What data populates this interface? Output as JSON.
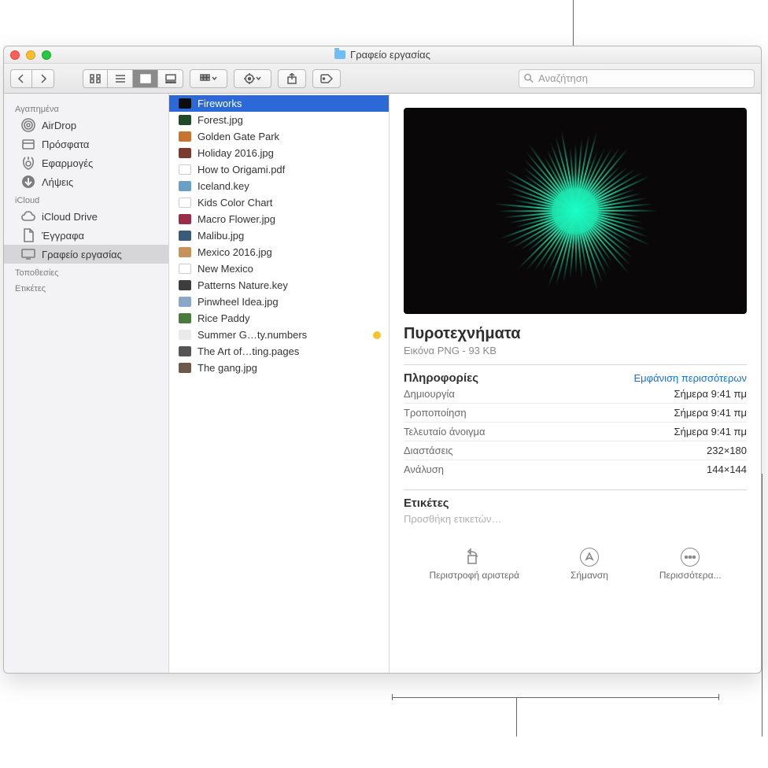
{
  "window": {
    "title": "Γραφείο εργασίας"
  },
  "search": {
    "placeholder": "Αναζήτηση"
  },
  "sidebar": {
    "sections": [
      {
        "header": "Αγαπημένα",
        "items": [
          {
            "label": "AirDrop",
            "icon": "airdrop"
          },
          {
            "label": "Πρόσφατα",
            "icon": "recents"
          },
          {
            "label": "Εφαρμογές",
            "icon": "apps"
          },
          {
            "label": "Λήψεις",
            "icon": "downloads"
          }
        ]
      },
      {
        "header": "iCloud",
        "items": [
          {
            "label": "iCloud Drive",
            "icon": "cloud"
          },
          {
            "label": "Έγγραφα",
            "icon": "doc"
          },
          {
            "label": "Γραφείο εργασίας",
            "icon": "desktop",
            "selected": true
          }
        ]
      },
      {
        "header": "Τοποθεσίες",
        "items": []
      },
      {
        "header": "Ετικέτες",
        "items": []
      }
    ]
  },
  "files": [
    {
      "name": "Fireworks",
      "color": "#0d0d0d",
      "selected": true
    },
    {
      "name": "Forest.jpg",
      "color": "#1e4a27"
    },
    {
      "name": "Golden Gate Park",
      "color": "#c87430"
    },
    {
      "name": "Holiday 2016.jpg",
      "color": "#7a3a2f"
    },
    {
      "name": "How to Origami.pdf",
      "color": "#ffffff",
      "doc": true
    },
    {
      "name": "Iceland.key",
      "color": "#6aa0c7"
    },
    {
      "name": "Kids Color Chart",
      "color": "#ffffff",
      "doc": true
    },
    {
      "name": "Macro Flower.jpg",
      "color": "#9b2d48"
    },
    {
      "name": "Malibu.jpg",
      "color": "#3a5a7a"
    },
    {
      "name": "Mexico 2016.jpg",
      "color": "#c7925a"
    },
    {
      "name": "New Mexico",
      "color": "#ffffff",
      "doc": true
    },
    {
      "name": "Patterns Nature.key",
      "color": "#3d3d3d"
    },
    {
      "name": "Pinwheel Idea.jpg",
      "color": "#8aa7c9"
    },
    {
      "name": "Rice Paddy",
      "color": "#4a7b3d"
    },
    {
      "name": "Summer G…ty.numbers",
      "color": "#eaeaea",
      "tag": "#f4c430"
    },
    {
      "name": "The Art of…ting.pages",
      "color": "#555"
    },
    {
      "name": "The gang.jpg",
      "color": "#6d5a4a"
    }
  ],
  "preview": {
    "title": "Πυροτεχνήματα",
    "subtitle": "Εικόνα PNG - 93 KB",
    "info_header": "Πληροφορίες",
    "show_more": "Εμφάνιση περισσότερων",
    "rows": [
      {
        "k": "Δημιουργία",
        "v": "Σήμερα 9:41 πμ"
      },
      {
        "k": "Τροποποίηση",
        "v": "Σήμερα 9:41 πμ"
      },
      {
        "k": "Τελευταίο άνοιγμα",
        "v": "Σήμερα 9:41 πμ"
      },
      {
        "k": "Διαστάσεις",
        "v": "232×180"
      },
      {
        "k": "Ανάλυση",
        "v": "144×144"
      }
    ],
    "tags_header": "Ετικέτες",
    "tags_placeholder": "Προσθήκη ετικετών…",
    "actions": {
      "rotate": "Περιστροφή αριστερά",
      "markup": "Σήμανση",
      "more": "Περισσότερα..."
    }
  }
}
